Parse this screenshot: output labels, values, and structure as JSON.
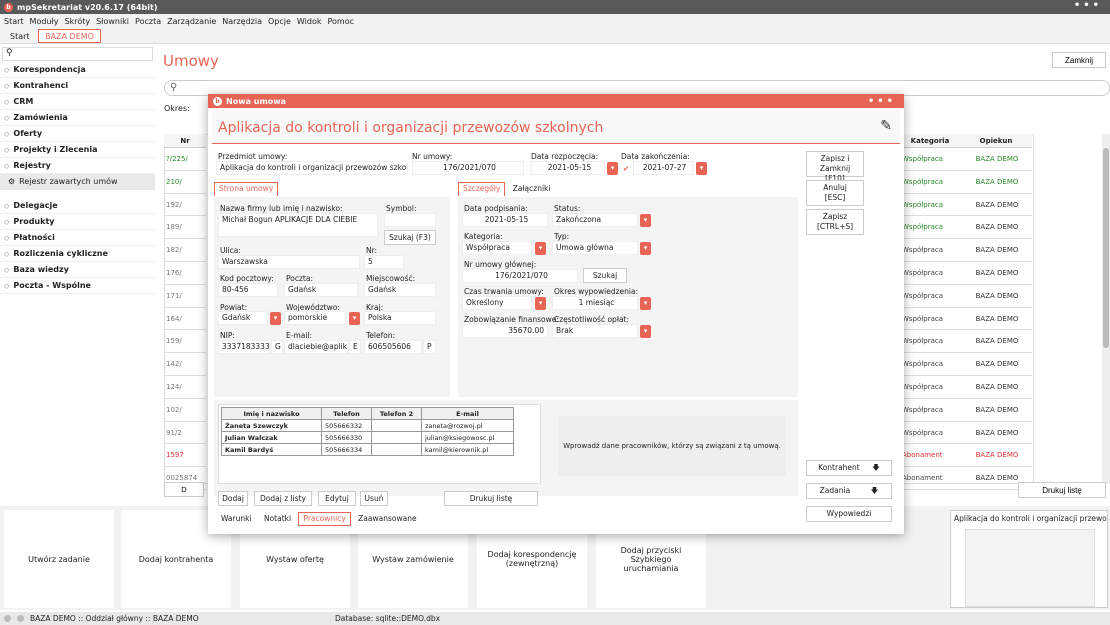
{
  "app": {
    "title": "mpSekretariat v20.6.17 (64bit)"
  },
  "menu": [
    "Start",
    "Moduły",
    "Skróty",
    "Słowniki",
    "Poczta",
    "Zarządzanie",
    "Narzędzia",
    "Opcje",
    "Widok",
    "Pomoc"
  ],
  "apptabs": [
    "Start",
    "BAZA DEMO"
  ],
  "sidebar": {
    "search_placeholder": "",
    "items": [
      "Korespondencja",
      "Kontrahenci",
      "CRM",
      "Zamówienia",
      "Oferty",
      "Projekty i Zlecenia",
      "Rejestry"
    ],
    "subitem": "Rejestr zawartych umów",
    "items2": [
      "Delegacje",
      "Produkty",
      "Płatności",
      "Rozliczenia cykliczne",
      "Baza wiedzy",
      "Poczta - Wspólne"
    ]
  },
  "main": {
    "title": "Umowy",
    "close": "Zamknij",
    "okres": "Okres:",
    "print": "Drukuj listę",
    "d_btn": "D",
    "nr_header": "Nr",
    "nr_values": [
      "?/225/",
      "210/",
      "192/",
      "189/",
      "182/",
      "176/",
      "171/",
      "164/",
      "159/",
      "142/",
      "124/",
      "102/",
      "91/2",
      "1597",
      "0025874"
    ],
    "kat_header": "Kategoria",
    "kat_values": [
      "Współpraca",
      "Współpraca",
      "Współpraca",
      "Współpraca",
      "Współpraca",
      "Współpraca",
      "Współpraca",
      "Współpraca",
      "Współpraca",
      "Współpraca",
      "Współpraca",
      "Współpraca",
      "Współpraca",
      "Abonament",
      "Abonament"
    ],
    "op_header": "Opiekun",
    "op_values": [
      "BAZA DEMO",
      "BAZA DEMO",
      "BAZA DEMO",
      "BAZA DEMO",
      "BAZA DEMO",
      "BAZA DEMO",
      "BAZA DEMO",
      "BAZA DEMO",
      "BAZA DEMO",
      "BAZA DEMO",
      "BAZA DEMO",
      "BAZA DEMO",
      "BAZA DEMO",
      "BAZA DEMO",
      "BAZA DEMO"
    ]
  },
  "bottom": {
    "tiles": [
      "Utwórz zadanie",
      "Dodaj kontrahenta",
      "Wystaw ofertę",
      "Wystaw zamówienie",
      "Dodaj korespondencję (zewnętrzną)",
      "Dodaj przyciski Szybkiego uruchamiania"
    ],
    "preview_title": "Aplikacja do kontroli i organizacji przewozó..."
  },
  "status": {
    "left": "BAZA DEMO :: Oddział główny :: BAZA DEMO",
    "db": "Database: sqlite::DEMO.dbx"
  },
  "dialog": {
    "title": "Nowa umowa",
    "heading": "Aplikacja do kontroli i organizacji przewozów szkolnych",
    "przedmiot_lbl": "Przedmiot umowy:",
    "przedmiot": "Aplikacja do kontroli i organizacji przewozów szkolnych",
    "nr_lbl": "Nr umowy:",
    "nr": "176/2021/070",
    "start_lbl": "Data rozpoczęcia:",
    "start": "2021-05-15",
    "end_lbl": "Data zakończenia:",
    "end": "2021-07-27",
    "tab_strona": "Strona umowy",
    "firma_lbl": "Nazwa firmy lub imię i nazwisko:",
    "firma": "Michał Bogun APLIKACJE DLA CIEBIE",
    "symbol_lbl": "Symbol:",
    "szukaj_f3": "Szukaj (F3)",
    "ulica_lbl": "Ulica:",
    "ulica": "Warszawska",
    "nr_lbl2": "Nr:",
    "nr_dom": "5",
    "kod_lbl": "Kod pocztowy:",
    "kod": "80-456",
    "poczta_lbl": "Poczta:",
    "poczta": "Gdańsk",
    "miejsc_lbl": "Miejscowość:",
    "miejsc": "Gdańsk",
    "powiat_lbl": "Powiat:",
    "powiat": "Gdańsk",
    "woj_lbl": "Województwo:",
    "woj": "pomorskie",
    "kraj_lbl": "Kraj:",
    "kraj": "Polska",
    "nip_lbl": "NIP:",
    "nip": "3337183333",
    "nip_g": "G",
    "email_lbl": "E-mail:",
    "email": "dlaciebie@aplikac",
    "email_e": "E",
    "tel_lbl": "Telefon:",
    "tel": "606505606",
    "tel_p": "P",
    "tab_szczegoly": "Szczegóły",
    "tab_zalaczniki": "Załączniki",
    "podpis_lbl": "Data podpisania:",
    "podpis": "2021-05-15",
    "status_lbl": "Status:",
    "status": "Zakończona",
    "kat_lbl": "Kategoria:",
    "kat": "Współpraca",
    "typ_lbl": "Typ:",
    "typ": "Umowa główna",
    "glowna_lbl": "Nr umowy głównej:",
    "glowna": "176/2021/070",
    "szukaj": "Szukaj",
    "czas_lbl": "Czas trwania umowy:",
    "czas": "Określony",
    "okres_lbl": "Okres wypowiedzenia:",
    "okres": "1 miesiąc",
    "zob_lbl": "Zobowiązanie finansowe:",
    "zob": "35670.00",
    "czest_lbl": "Częstotliwość opłat:",
    "czest": "Brak",
    "btn_zapisz_zamknij": "Zapisz i Zamknij",
    "btn_zapisz_zamknij_k": "[F10]",
    "btn_anuluj": "Anuluj",
    "btn_anuluj_k": "[ESC]",
    "btn_zapisz": "Zapisz",
    "btn_zapisz_k": "[CTRL+S]",
    "btn_kontrahent": "Kontrahent",
    "btn_zadania": "Zadania",
    "btn_wypowiedzi": "Wypowiedzi",
    "emp_headers": [
      "Imię i nazwisko",
      "Telefon",
      "Telefon 2",
      "E-mail"
    ],
    "emp_rows": [
      [
        "Żaneta Szewczyk",
        "505666332",
        "",
        "zaneta@rozwoj.pl"
      ],
      [
        "Julian Walczak",
        "505666330",
        "",
        "julian@ksiegowosc.pl"
      ],
      [
        "Kamil Bardyś",
        "505666334",
        "",
        "kamil@kierownik.pl"
      ]
    ],
    "emp_hint": "Wprowadź dane pracowników, którzy są związani z tą umową.",
    "btn_dodaj": "Dodaj",
    "btn_dodaj_listy": "Dodaj z listy",
    "btn_edytuj": "Edytuj",
    "btn_usun": "Usuń",
    "btn_drukuj": "Drukuj listę",
    "bottomtabs": [
      "Warunki",
      "Notatki",
      "Pracownicy",
      "Zaawansowane"
    ]
  }
}
